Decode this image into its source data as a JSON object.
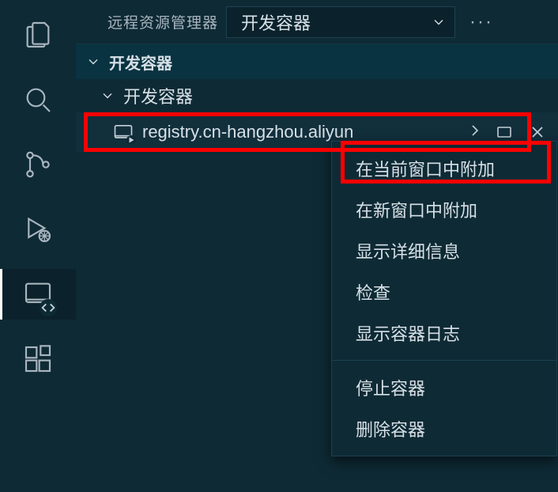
{
  "sidebar": {
    "title": "远程资源管理器",
    "dropdown": {
      "value": "开发容器"
    }
  },
  "section": {
    "label": "开发容器"
  },
  "tree": {
    "group_label": "开发容器",
    "item": {
      "label": "registry.cn-hangzhou.aliyun"
    }
  },
  "context_menu": {
    "items": [
      "在当前窗口中附加",
      "在新窗口中附加",
      "显示详细信息",
      "检查",
      "显示容器日志"
    ],
    "items2": [
      "停止容器",
      "删除容器"
    ]
  }
}
